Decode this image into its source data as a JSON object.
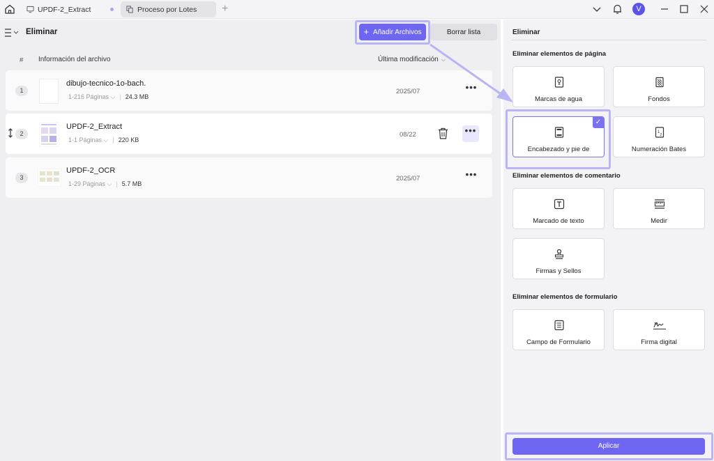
{
  "titlebar": {
    "tabs": [
      {
        "label": "UPDF-2_Extract",
        "icon": "pdf-icon"
      },
      {
        "label": "Proceso por Lotes",
        "icon": "batch-icon"
      }
    ],
    "avatar_letter": "V"
  },
  "toolbar": {
    "title": "Eliminar",
    "add_files_label": "Añadir Archivos",
    "clear_list_label": "Borrar lista"
  },
  "table": {
    "col_index": "#",
    "col_info": "Información del archivo",
    "col_modified": "Última modificación",
    "rows": [
      {
        "index": "1",
        "name": "dibujo-tecnico-1o-bach.",
        "pages": "1-216 Páginas",
        "size": "24.3 MB",
        "date": "2025/07"
      },
      {
        "index": "2",
        "name": "UPDF-2_Extract",
        "pages": "1-1 Páginas",
        "size": "220 KB",
        "date": "08/22"
      },
      {
        "index": "3",
        "name": "UPDF-2_OCR",
        "pages": "1-29 Páginas",
        "size": "5.7 MB",
        "date": "2025/07"
      }
    ]
  },
  "panel": {
    "title": "Eliminar",
    "sections": [
      {
        "title": "Eliminar elementos de página"
      },
      {
        "title": "Eliminar elementos de comentario"
      },
      {
        "title": "Eliminar elementos de formulario"
      }
    ],
    "cards": [
      {
        "label": "Marcas de agua",
        "icon": "watermark-icon"
      },
      {
        "label": "Fondos",
        "icon": "background-icon"
      },
      {
        "label": "Encabezado y pie de",
        "icon": "header-footer-icon",
        "selected": true
      },
      {
        "label": "Numeración Bates",
        "icon": "bates-number-icon"
      },
      {
        "label": "Marcado de texto",
        "icon": "text-markup-icon"
      },
      {
        "label": "Medir",
        "icon": "measure-icon"
      },
      {
        "label": "Firmas y Sellos",
        "icon": "stamp-icon"
      },
      {
        "label": "Campo de Formulario",
        "icon": "form-field-icon"
      },
      {
        "label": "Firma digital",
        "icon": "digital-signature-icon"
      }
    ],
    "apply_label": "Aplicar"
  },
  "colors": {
    "accent": "#6e66f0",
    "highlight": "#b9b4f3"
  }
}
